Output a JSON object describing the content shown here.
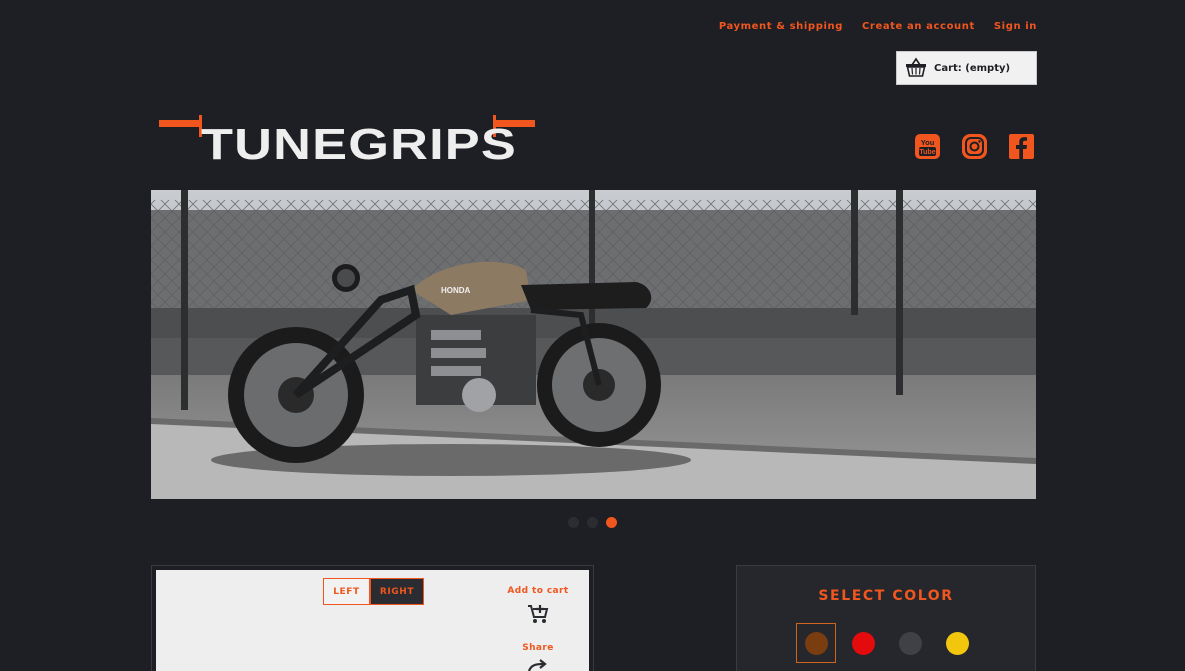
{
  "header": {
    "links": [
      "Payment & shipping",
      "Create an account",
      "Sign in"
    ],
    "cart_label": "Cart: (empty)"
  },
  "brand": {
    "logo_text": "TUNEGRIPS",
    "accent": "#f0561e"
  },
  "social": {
    "icons": [
      "youtube-icon",
      "instagram-icon",
      "facebook-icon"
    ]
  },
  "hero": {
    "slide_count": 3,
    "active_slide": 3,
    "motorcycle_badge": "HONDA"
  },
  "product": {
    "toggle": [
      "LEFT",
      "RIGHT"
    ],
    "selected_side": "RIGHT",
    "add_to_cart": "Add to cart",
    "share": "Share"
  },
  "colors": {
    "title": "SELECT COLOR",
    "swatches": [
      "#7a3d10",
      "#e30b0b",
      "#404145",
      "#f1c60c"
    ],
    "selected": 0
  }
}
